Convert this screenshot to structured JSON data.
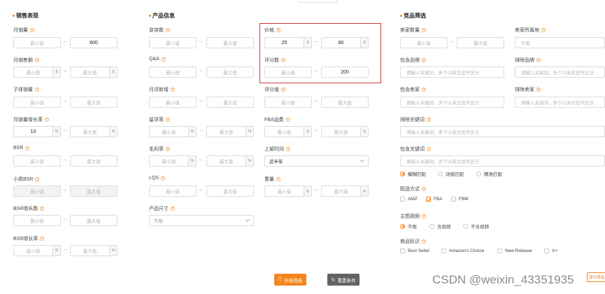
{
  "sections": {
    "sales": "销售表现",
    "product": "产品信息",
    "competitor": "竞品筛选"
  },
  "placeholders": {
    "min": "最小值",
    "max": "最大值",
    "unlimited": "不限",
    "keywords": "请输入关键词，多个以英文逗号区分"
  },
  "units": {
    "dollar": "$",
    "percent": "%",
    "gram": "g"
  },
  "separator": "~",
  "sales": {
    "monthly_sales": {
      "label": "月销量",
      "min": "",
      "max": "600"
    },
    "monthly_revenue": {
      "label": "月销售额"
    },
    "child_sales": {
      "label": "子体销量"
    },
    "monthly_growth": {
      "label": "月销量增长率",
      "min": "10",
      "max": ""
    },
    "bsr": {
      "label": "BSR"
    },
    "sub_bsr": {
      "label": "小类BSR"
    },
    "bsr_growth_count": {
      "label": "BSR增长数"
    },
    "bsr_growth_rate": {
      "label": "BSR增长率"
    }
  },
  "product": {
    "variants": {
      "label": "变体数"
    },
    "qa": {
      "label": "Q&A"
    },
    "monthly_new_reviews": {
      "label": "月评新增"
    },
    "review_rate": {
      "label": "留评率"
    },
    "gross_margin": {
      "label": "毛利率"
    },
    "lqs": {
      "label": "LQS"
    },
    "size": {
      "label": "产品尺寸",
      "value": "不限"
    }
  },
  "product2": {
    "price": {
      "label": "价格",
      "min": "25",
      "max": "80"
    },
    "review_count": {
      "label": "评分数",
      "min": "",
      "max": "200"
    },
    "rating": {
      "label": "评分值"
    },
    "fba_fee": {
      "label": "FBA运费"
    },
    "launch_time": {
      "label": "上架时间",
      "value": "近半年"
    },
    "weight": {
      "label": "重量"
    }
  },
  "competitor": {
    "seller_count": {
      "label": "卖家数量"
    },
    "seller_location": {
      "label": "卖家所属地",
      "value": "不限"
    },
    "include_brand": {
      "label": "包含品牌"
    },
    "exclude_brand": {
      "label": "排除品牌"
    },
    "include_seller": {
      "label": "包含卖家"
    },
    "exclude_seller": {
      "label": "排除卖家"
    },
    "exclude_keywords": {
      "label": "排除关键词"
    },
    "include_keywords": {
      "label": "包含关键词"
    },
    "match_modes": [
      "模糊匹配",
      "词组匹配",
      "精准匹配"
    ],
    "fulfillment": {
      "label": "配送方式",
      "options": [
        "AMZ",
        "FBA",
        "FBM"
      ]
    },
    "main_video": {
      "label": "主图视频",
      "options": [
        "不限",
        "含视频",
        "不含视频"
      ]
    },
    "product_tags": {
      "label": "商品标识",
      "options": [
        "Best Seller",
        "Amazon's Choice",
        "New Release",
        "A+"
      ]
    }
  },
  "buttons": {
    "start": "开始筛选",
    "reset": "重置条件"
  },
  "side_tab": "保存筛选",
  "watermark": "CSDN @weixin_43351935",
  "colors": {
    "accent": "#f5861f",
    "highlight_box": "#d63a3a"
  }
}
